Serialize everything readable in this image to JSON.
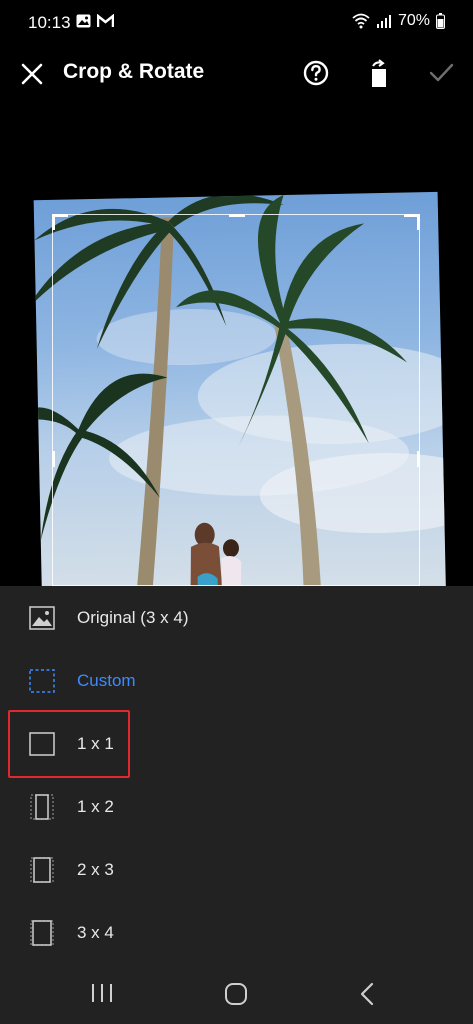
{
  "status_bar": {
    "time": "10:13",
    "battery": "70%",
    "icons": [
      "gallery-icon",
      "gmail-icon",
      "wifi-icon",
      "signal-icon",
      "battery-icon"
    ]
  },
  "header": {
    "title": "Crop & Rotate",
    "actions": [
      "close-icon",
      "help-icon",
      "rotate-icon",
      "check-icon"
    ]
  },
  "aspect_options": [
    {
      "label": "Original (3 x 4)",
      "icon": "image-icon",
      "selected": false
    },
    {
      "label": "Custom",
      "icon": "dashed-square-icon",
      "selected": true
    },
    {
      "label": "1 x 1",
      "icon": "square-icon",
      "selected": false,
      "highlighted": true
    },
    {
      "label": "1 x 2",
      "icon": "portrait-1x2-icon",
      "selected": false
    },
    {
      "label": "2 x 3",
      "icon": "portrait-2x3-icon",
      "selected": false
    },
    {
      "label": "3 x 4",
      "icon": "portrait-3x4-icon",
      "selected": false
    }
  ],
  "colors": {
    "background": "#000000",
    "sheet": "#222222",
    "accent": "#3b8bff",
    "highlight": "#e0282e"
  },
  "nav_bar": [
    "recent-apps-icon",
    "home-icon",
    "back-icon"
  ]
}
